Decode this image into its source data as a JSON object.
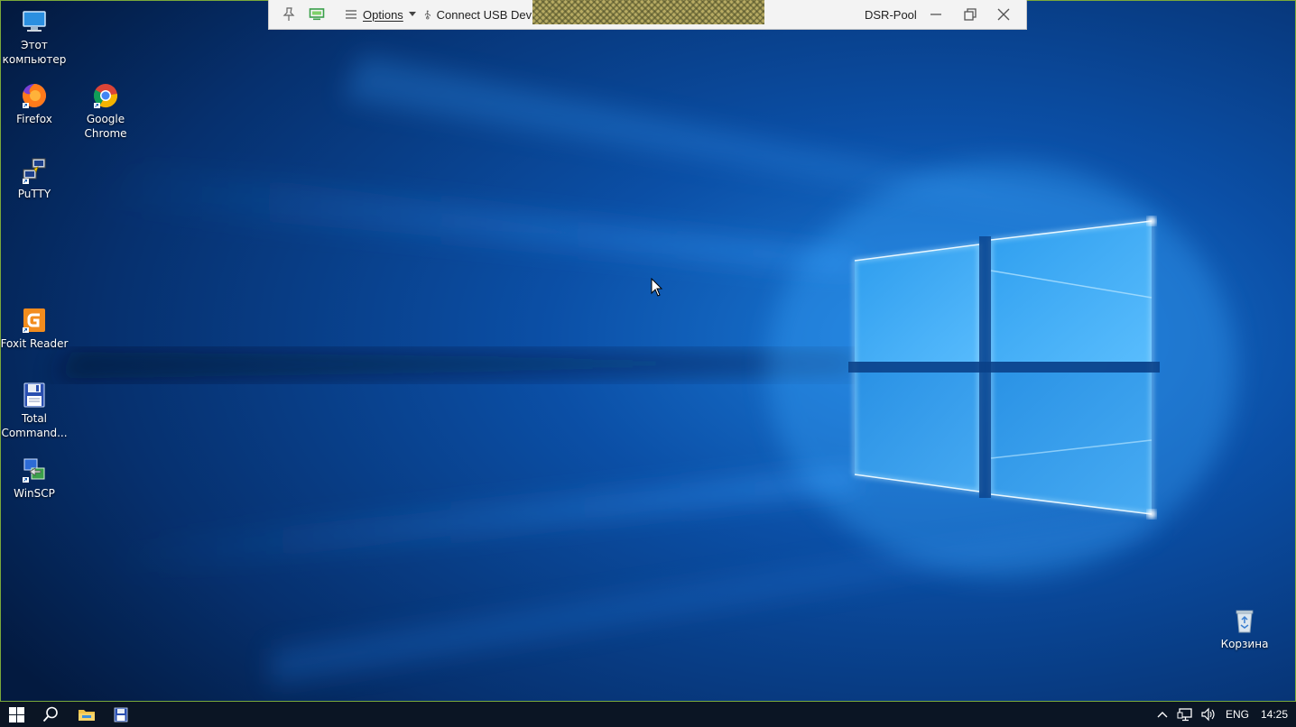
{
  "remote_bar": {
    "options_label": "Options",
    "usb_label": "Connect USB Devi",
    "connection_name": "DSR-Pool"
  },
  "desktop": {
    "icons": {
      "this_pc": "Этот\nкомпьютер",
      "firefox": "Firefox",
      "chrome": "Google\nChrome",
      "putty": "PuTTY",
      "foxit": "Foxit Reader",
      "total_commander": "Total\nCommand...",
      "winscp": "WinSCP",
      "recycle_bin": "Корзина"
    }
  },
  "taskbar": {
    "language": "ENG",
    "time": "14:25"
  },
  "colors": {
    "wallpaper_dark": "#03163a",
    "wallpaper_blue": "#0a5bb8",
    "window_glow": "#8fd3ff",
    "frame_accent": "#7aa83a",
    "taskbar": "#0b1524"
  }
}
